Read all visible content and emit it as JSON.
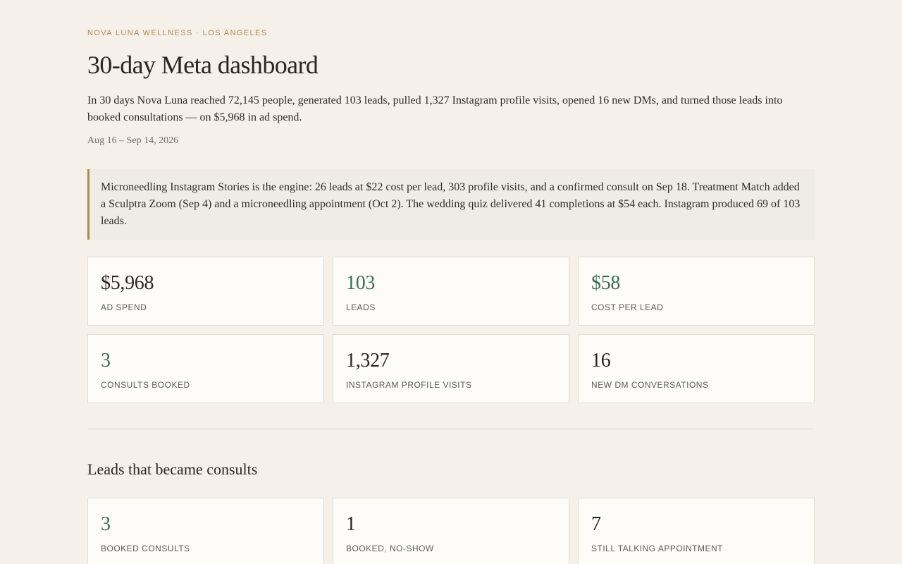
{
  "header": {
    "eyebrow": "NOVA LUNA WELLNESS · LOS ANGELES",
    "title": "30-day Meta dashboard",
    "summary": "In 30 days Nova Luna reached 72,145 people, generated 103 leads, pulled 1,327 Instagram profile visits, opened 16 new DMs, and turned those leads into booked consultations — on $5,968 in ad spend.",
    "date_range": "Aug 16 – Sep 14, 2026"
  },
  "callout": {
    "text": "Microneedling Instagram Stories is the engine: 26 leads at $22 cost per lead, 303 profile visits, and a confirmed consult on Sep 18. Treatment Match added a Sculptra Zoom (Sep 4) and a microneedling appointment (Oct 2). The wedding quiz delivered 41 completions at $54 each. Instagram produced 69 of 103 leads."
  },
  "colors": {
    "accent": "#b08a4a",
    "positive": "#3c6e58",
    "background": "#f6f0eb",
    "card": "#fdfcf9"
  },
  "kpis": [
    {
      "value": "$5,968",
      "label": "AD SPEND"
    },
    {
      "value": "103",
      "label": "LEADS"
    },
    {
      "value": "$58",
      "label": "COST PER LEAD"
    },
    {
      "value": "3",
      "label": "CONSULTS BOOKED"
    },
    {
      "value": "1,327",
      "label": "INSTAGRAM PROFILE VISITS"
    },
    {
      "value": "16",
      "label": "NEW DM CONVERSATIONS"
    }
  ],
  "consults_section": {
    "title": "Leads that became consults",
    "cards": [
      {
        "value": "3",
        "label": "BOOKED CONSULTS"
      },
      {
        "value": "1",
        "label": "BOOKED, NO-SHOW"
      },
      {
        "value": "7",
        "label": "STILL TALKING APPOINTMENT"
      }
    ]
  }
}
